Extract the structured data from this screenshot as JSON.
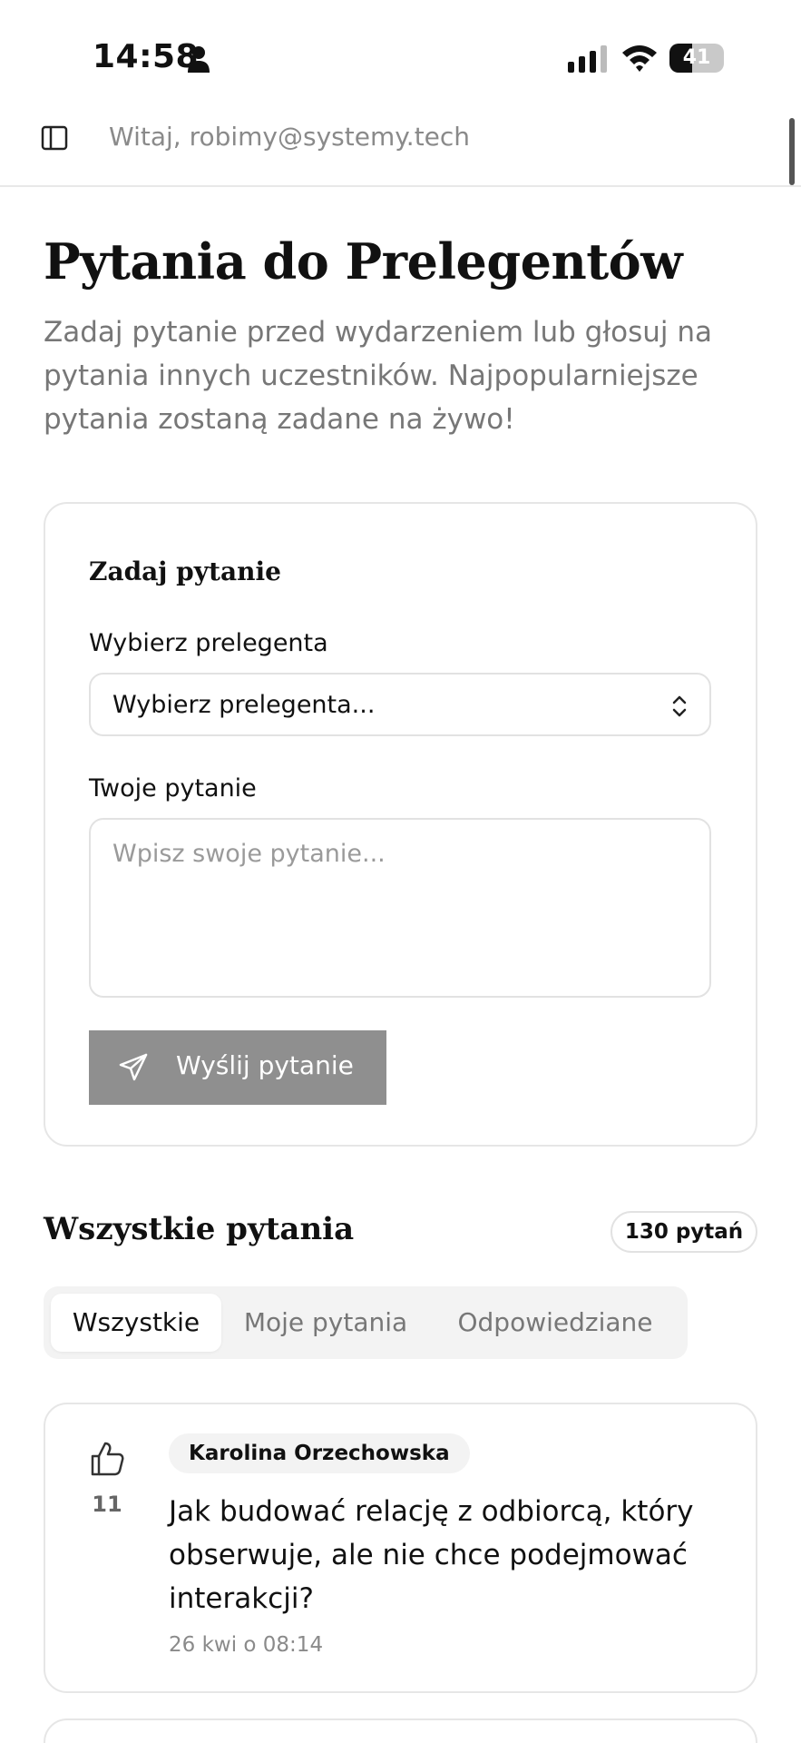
{
  "status_bar": {
    "time": "14:58",
    "battery_level": "41"
  },
  "header": {
    "greeting": "Witaj, robimy@systemy.tech"
  },
  "page": {
    "title": "Pytania do Prelegentów",
    "subtitle": "Zadaj pytanie przed wydarzeniem lub głosuj na pytania innych uczestników. Najpopularniejsze pytania zostaną zadane na żywo!"
  },
  "ask_form": {
    "title": "Zadaj pytanie",
    "speaker_label": "Wybierz prelegenta",
    "speaker_value": "Wybierz prelegenta...",
    "question_label": "Twoje pytanie",
    "question_placeholder": "Wpisz swoje pytanie...",
    "submit_label": "Wyślij pytanie"
  },
  "questions_section": {
    "title": "Wszystkie pytania",
    "count": "130 pytań",
    "tabs": [
      {
        "label": "Wszystkie",
        "active": true
      },
      {
        "label": "Moje pytania",
        "active": false
      },
      {
        "label": "Odpowiedziane",
        "active": false
      }
    ],
    "items": [
      {
        "votes": "11",
        "speaker": "Karolina Orzechowska",
        "text": "Jak budować relację z odbiorcą, który obserwuje, ale nie chce podejmować interakcji?",
        "time": "26 kwi o 08:14"
      }
    ]
  },
  "colors": {
    "submit_disabled": "#8f8f8f",
    "muted_text": "#777777",
    "border": "#e6e6e6"
  }
}
